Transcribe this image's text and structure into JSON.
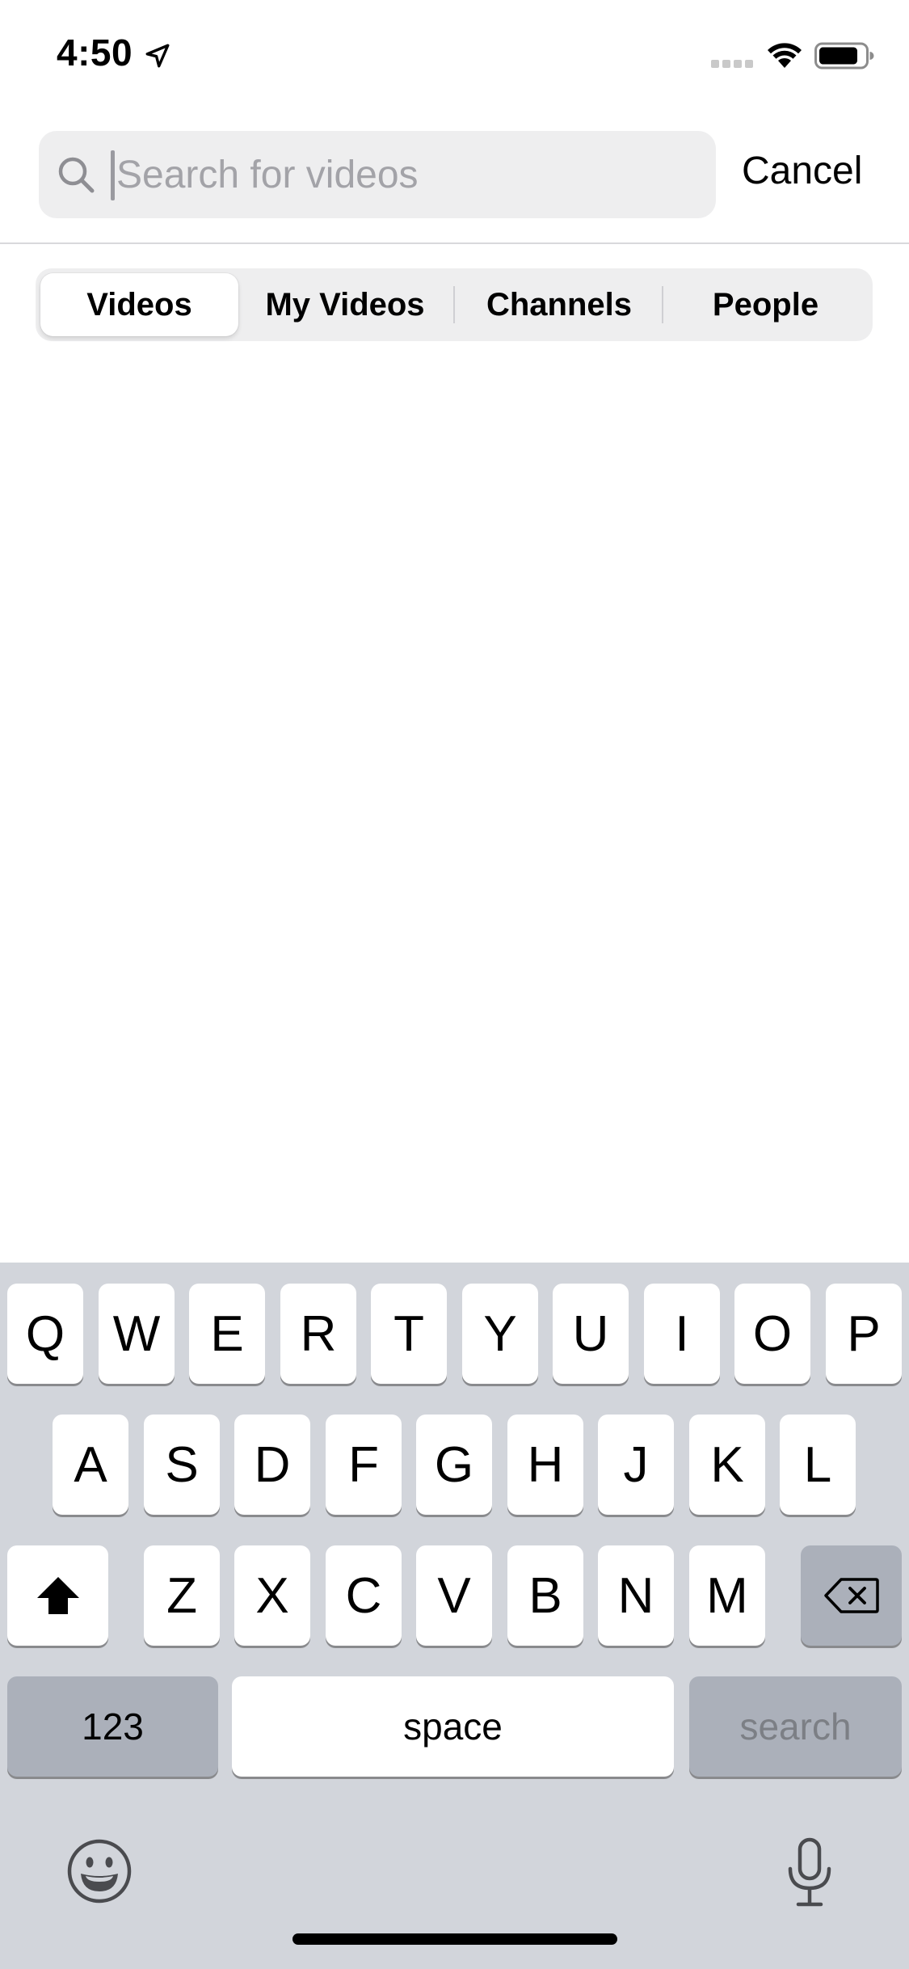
{
  "status_bar": {
    "time": "4:50",
    "location_icon": "location-arrow-icon",
    "signal_icon": "cellular-signal-icon",
    "wifi_icon": "wifi-icon",
    "battery_icon": "battery-icon"
  },
  "search": {
    "placeholder": "Search for videos",
    "value": "",
    "icon": "magnifying-glass-icon",
    "cancel_label": "Cancel"
  },
  "tabs": [
    {
      "label": "Videos",
      "selected": true
    },
    {
      "label": "My Videos",
      "selected": false
    },
    {
      "label": "Channels",
      "selected": false
    },
    {
      "label": "People",
      "selected": false
    }
  ],
  "keyboard": {
    "row1": [
      "Q",
      "W",
      "E",
      "R",
      "T",
      "Y",
      "U",
      "I",
      "O",
      "P"
    ],
    "row2": [
      "A",
      "S",
      "D",
      "F",
      "G",
      "H",
      "J",
      "K",
      "L"
    ],
    "row3": [
      "Z",
      "X",
      "C",
      "V",
      "B",
      "N",
      "M"
    ],
    "shift_icon": "shift-arrow-icon",
    "delete_icon": "delete-backspace-icon",
    "numbers_label": "123",
    "space_label": "space",
    "search_label": "search",
    "emoji_icon": "emoji-icon",
    "mic_icon": "microphone-icon"
  },
  "colors": {
    "keyboard_background": "#d2d5db",
    "key_light": "#ffffff",
    "key_dark": "#abb0ba",
    "search_field_background": "#eeeeef"
  }
}
